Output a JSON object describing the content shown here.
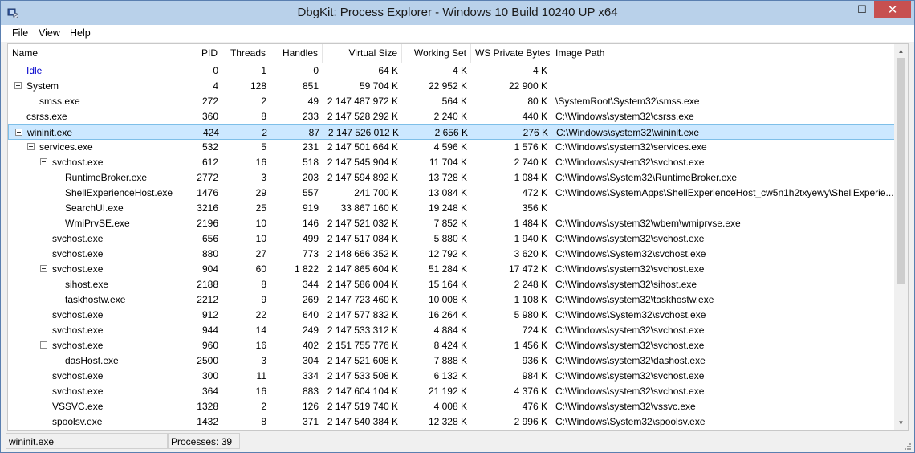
{
  "window": {
    "title": "DbgKit: Process Explorer - Windows 10 Build 10240 UP x64",
    "minimize_glyph": "—",
    "maximize_glyph": "☐",
    "close_glyph": "✕"
  },
  "menu": {
    "file": "File",
    "view": "View",
    "help": "Help"
  },
  "columns": {
    "name": "Name",
    "pid": "PID",
    "threads": "Threads",
    "handles": "Handles",
    "virtual_size": "Virtual Size",
    "working_set": "Working Set",
    "ws_private": "WS Private Bytes",
    "image_path": "Image Path"
  },
  "processes": [
    {
      "name": "Idle",
      "depth": 0,
      "expander": false,
      "pid": "0",
      "threads": "1",
      "handles": "0",
      "vsize": "64 K",
      "wset": "4 K",
      "wspriv": "4 K",
      "path": ""
    },
    {
      "name": "System",
      "depth": 0,
      "expander": true,
      "pid": "4",
      "threads": "128",
      "handles": "851",
      "vsize": "59 704 K",
      "wset": "22 952 K",
      "wspriv": "22 900 K",
      "path": ""
    },
    {
      "name": "smss.exe",
      "depth": 1,
      "expander": false,
      "pid": "272",
      "threads": "2",
      "handles": "49",
      "vsize": "2 147 487 972 K",
      "wset": "564 K",
      "wspriv": "80 K",
      "path": "\\SystemRoot\\System32\\smss.exe"
    },
    {
      "name": "csrss.exe",
      "depth": 0,
      "expander": false,
      "pid": "360",
      "threads": "8",
      "handles": "233",
      "vsize": "2 147 528 292 K",
      "wset": "2 240 K",
      "wspriv": "440 K",
      "path": "C:\\Windows\\system32\\csrss.exe"
    },
    {
      "name": "wininit.exe",
      "depth": 0,
      "expander": true,
      "selected": true,
      "pid": "424",
      "threads": "2",
      "handles": "87",
      "vsize": "2 147 526 012 K",
      "wset": "2 656 K",
      "wspriv": "276 K",
      "path": "C:\\Windows\\system32\\wininit.exe"
    },
    {
      "name": "services.exe",
      "depth": 1,
      "expander": true,
      "pid": "532",
      "threads": "5",
      "handles": "231",
      "vsize": "2 147 501 664 K",
      "wset": "4 596 K",
      "wspriv": "1 576 K",
      "path": "C:\\Windows\\system32\\services.exe"
    },
    {
      "name": "svchost.exe",
      "depth": 2,
      "expander": true,
      "pid": "612",
      "threads": "16",
      "handles": "518",
      "vsize": "2 147 545 904 K",
      "wset": "11 704 K",
      "wspriv": "2 740 K",
      "path": "C:\\Windows\\system32\\svchost.exe"
    },
    {
      "name": "RuntimeBroker.exe",
      "depth": 3,
      "expander": false,
      "pid": "2772",
      "threads": "3",
      "handles": "203",
      "vsize": "2 147 594 892 K",
      "wset": "13 728 K",
      "wspriv": "1 084 K",
      "path": "C:\\Windows\\System32\\RuntimeBroker.exe"
    },
    {
      "name": "ShellExperienceHost.exe",
      "depth": 3,
      "expander": false,
      "pid": "1476",
      "threads": "29",
      "handles": "557",
      "vsize": "241 700 K",
      "wset": "13 084 K",
      "wspriv": "472 K",
      "path": "C:\\Windows\\SystemApps\\ShellExperienceHost_cw5n1h2txyewy\\ShellExperie..."
    },
    {
      "name": "SearchUI.exe",
      "depth": 3,
      "expander": false,
      "pid": "3216",
      "threads": "25",
      "handles": "919",
      "vsize": "33 867 160 K",
      "wset": "19 248 K",
      "wspriv": "356 K",
      "path": ""
    },
    {
      "name": "WmiPrvSE.exe",
      "depth": 3,
      "expander": false,
      "pid": "2196",
      "threads": "10",
      "handles": "146",
      "vsize": "2 147 521 032 K",
      "wset": "7 852 K",
      "wspriv": "1 484 K",
      "path": "C:\\Windows\\system32\\wbem\\wmiprvse.exe"
    },
    {
      "name": "svchost.exe",
      "depth": 2,
      "expander": false,
      "pid": "656",
      "threads": "10",
      "handles": "499",
      "vsize": "2 147 517 084 K",
      "wset": "5 880 K",
      "wspriv": "1 940 K",
      "path": "C:\\Windows\\system32\\svchost.exe"
    },
    {
      "name": "svchost.exe",
      "depth": 2,
      "expander": false,
      "pid": "880",
      "threads": "27",
      "handles": "773",
      "vsize": "2 148 666 352 K",
      "wset": "12 792 K",
      "wspriv": "3 620 K",
      "path": "C:\\Windows\\System32\\svchost.exe"
    },
    {
      "name": "svchost.exe",
      "depth": 2,
      "expander": true,
      "pid": "904",
      "threads": "60",
      "handles": "1 822",
      "vsize": "2 147 865 604 K",
      "wset": "51 284 K",
      "wspriv": "17 472 K",
      "path": "C:\\Windows\\system32\\svchost.exe"
    },
    {
      "name": "sihost.exe",
      "depth": 3,
      "expander": false,
      "pid": "2188",
      "threads": "8",
      "handles": "344",
      "vsize": "2 147 586 004 K",
      "wset": "15 164 K",
      "wspriv": "2 248 K",
      "path": "C:\\Windows\\system32\\sihost.exe"
    },
    {
      "name": "taskhostw.exe",
      "depth": 3,
      "expander": false,
      "pid": "2212",
      "threads": "9",
      "handles": "269",
      "vsize": "2 147 723 460 K",
      "wset": "10 008 K",
      "wspriv": "1 108 K",
      "path": "C:\\Windows\\system32\\taskhostw.exe"
    },
    {
      "name": "svchost.exe",
      "depth": 2,
      "expander": false,
      "pid": "912",
      "threads": "22",
      "handles": "640",
      "vsize": "2 147 577 832 K",
      "wset": "16 264 K",
      "wspriv": "5 980 K",
      "path": "C:\\Windows\\System32\\svchost.exe"
    },
    {
      "name": "svchost.exe",
      "depth": 2,
      "expander": false,
      "pid": "944",
      "threads": "14",
      "handles": "249",
      "vsize": "2 147 533 312 K",
      "wset": "4 884 K",
      "wspriv": "724 K",
      "path": "C:\\Windows\\system32\\svchost.exe"
    },
    {
      "name": "svchost.exe",
      "depth": 2,
      "expander": true,
      "pid": "960",
      "threads": "16",
      "handles": "402",
      "vsize": "2 151 755 776 K",
      "wset": "8 424 K",
      "wspriv": "1 456 K",
      "path": "C:\\Windows\\system32\\svchost.exe"
    },
    {
      "name": "dasHost.exe",
      "depth": 3,
      "expander": false,
      "pid": "2500",
      "threads": "3",
      "handles": "304",
      "vsize": "2 147 521 608 K",
      "wset": "7 888 K",
      "wspriv": "936 K",
      "path": "C:\\Windows\\system32\\dashost.exe"
    },
    {
      "name": "svchost.exe",
      "depth": 2,
      "expander": false,
      "pid": "300",
      "threads": "11",
      "handles": "334",
      "vsize": "2 147 533 508 K",
      "wset": "6 132 K",
      "wspriv": "984 K",
      "path": "C:\\Windows\\system32\\svchost.exe"
    },
    {
      "name": "svchost.exe",
      "depth": 2,
      "expander": false,
      "pid": "364",
      "threads": "16",
      "handles": "883",
      "vsize": "2 147 604 104 K",
      "wset": "21 192 K",
      "wspriv": "4 376 K",
      "path": "C:\\Windows\\system32\\svchost.exe"
    },
    {
      "name": "VSSVC.exe",
      "depth": 2,
      "expander": false,
      "pid": "1328",
      "threads": "2",
      "handles": "126",
      "vsize": "2 147 519 740 K",
      "wset": "4 008 K",
      "wspriv": "476 K",
      "path": "C:\\Windows\\system32\\vssvc.exe"
    },
    {
      "name": "spoolsv.exe",
      "depth": 2,
      "expander": false,
      "pid": "1432",
      "threads": "8",
      "handles": "371",
      "vsize": "2 147 540 384 K",
      "wset": "12 328 K",
      "wspriv": "2 996 K",
      "path": "C:\\Windows\\System32\\spoolsv.exe"
    }
  ],
  "status": {
    "selected_process": "wininit.exe",
    "process_count": "Processes: 39"
  }
}
